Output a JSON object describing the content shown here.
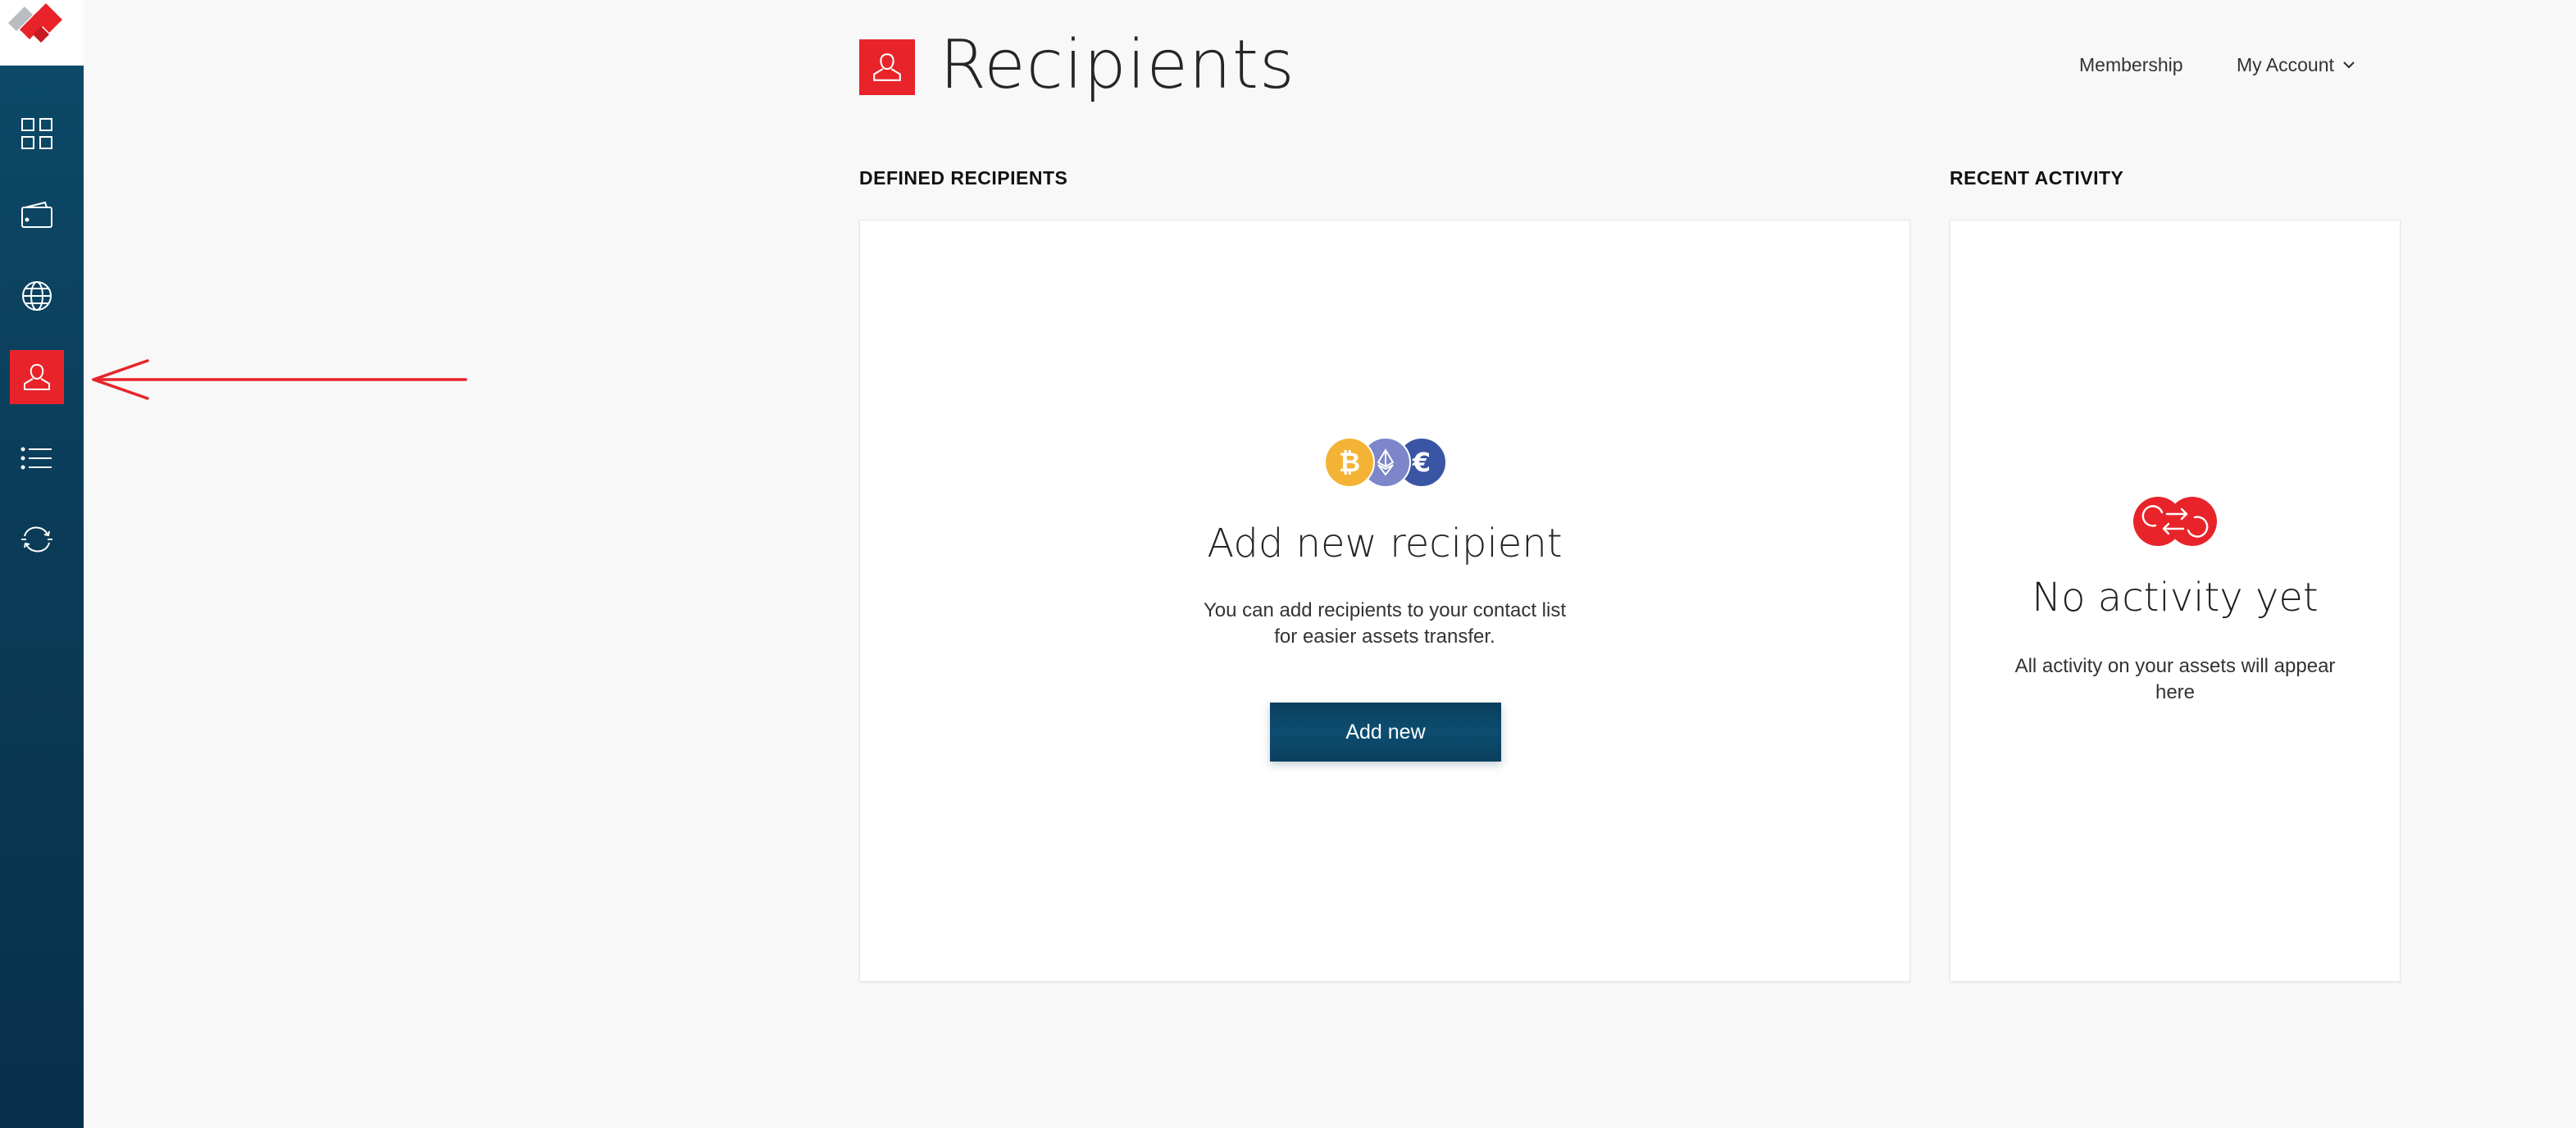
{
  "header": {
    "title": "Recipients",
    "page_icon": "recipient-icon",
    "links": {
      "membership": "Membership",
      "account": "My Account"
    }
  },
  "sidebar": {
    "logo": "diamond-logo",
    "items": [
      {
        "icon": "dashboard-grid-icon",
        "active": false
      },
      {
        "icon": "wallet-icon",
        "active": false
      },
      {
        "icon": "globe-icon",
        "active": false
      },
      {
        "icon": "recipient-icon",
        "active": true
      },
      {
        "icon": "list-icon",
        "active": false
      },
      {
        "icon": "exchange-icon",
        "active": false
      }
    ]
  },
  "sections": {
    "defined": {
      "label": "DEFINED RECIPIENTS",
      "coins": [
        {
          "symbol": "₿",
          "name": "bitcoin-icon",
          "color": "#f5b335"
        },
        {
          "symbol": "◆",
          "name": "ethereum-icon",
          "color": "#7c86c9"
        },
        {
          "symbol": "€",
          "name": "euro-icon",
          "color": "#3a55a4"
        }
      ],
      "heading": "Add new recipient",
      "description_line1": "You can add recipients to your contact list",
      "description_line2": "for easier assets transfer.",
      "button": "Add new"
    },
    "recent": {
      "label": "RECENT ACTIVITY",
      "icon": "activity-exchange-icon",
      "heading": "No activity yet",
      "description_line1": "All activity on your assets will appear",
      "description_line2": "here"
    }
  },
  "colors": {
    "accent": "#e8242a",
    "sidebar": "#0a3a55",
    "button": "#0a3f5e",
    "background": "#f8f8f8"
  }
}
